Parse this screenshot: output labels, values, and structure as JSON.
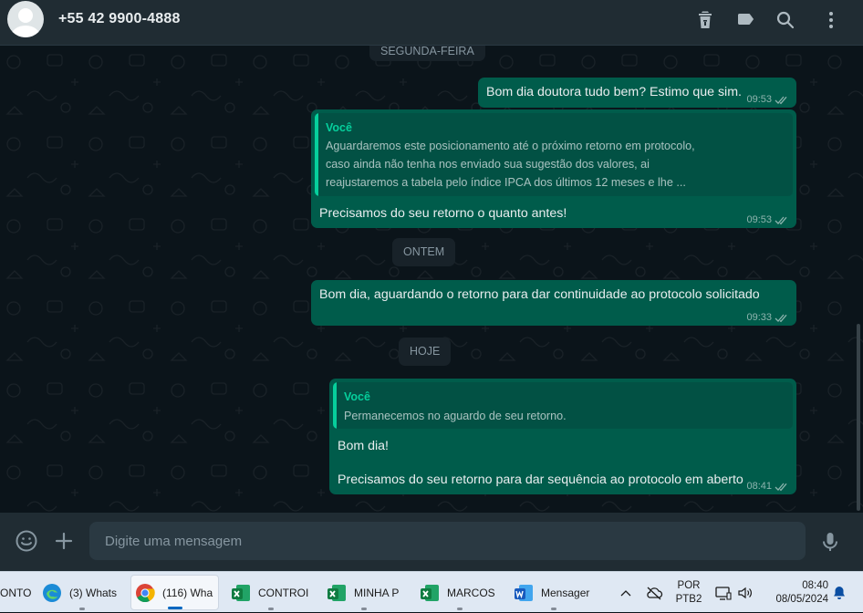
{
  "header": {
    "contact_name": "+55 42 9900-4888",
    "icons": [
      "avatar",
      "trash-icon",
      "label-icon",
      "search-icon",
      "menu-icon"
    ]
  },
  "chat": {
    "day_chips": {
      "monday": "SEGUNDA-FEIRA",
      "yesterday": "ONTEM",
      "today": "HOJE"
    },
    "messages": [
      {
        "text": "Bom dia doutora tudo bem? Estimo que sim.",
        "time": "09:53"
      },
      {
        "quote_author": "Você",
        "quote_text": "Aguardaremos este posicionamento até o próximo retorno em protocolo,\ncaso ainda não tenha nos enviado sua sugestão dos valores, ai\nreajustaremos a tabela pelo índice IPCA dos últimos 12 meses e lhe ...",
        "text": "Precisamos do seu retorno o quanto antes!",
        "time": "09:53"
      },
      {
        "text": "Bom dia, aguardando o retorno para dar continuidade ao protocolo solicitado",
        "time": "09:33"
      },
      {
        "quote_author": "Você",
        "quote_text": "Permanecemos no aguardo de seu retorno.",
        "text": "Bom dia!",
        "text2": "Precisamos do seu retorno para dar sequência ao protocolo em aberto",
        "time": "08:41"
      }
    ]
  },
  "composer": {
    "placeholder": "Digite uma mensagem"
  },
  "taskbar": {
    "items": [
      {
        "label": "ONTO",
        "icon": "app-icon"
      },
      {
        "label": "(3) Whats",
        "icon": "edge-icon"
      },
      {
        "label": "(116) Wha",
        "icon": "chrome-icon"
      },
      {
        "label": "CONTROI",
        "icon": "excel-icon"
      },
      {
        "label": "MINHA P",
        "icon": "excel-icon"
      },
      {
        "label": "MARCOS",
        "icon": "excel-icon"
      },
      {
        "label": "Mensager",
        "icon": "word-icon"
      }
    ],
    "language": "POR",
    "layout": "PTB2",
    "clock_time": "08:40",
    "clock_date": "08/05/2024"
  },
  "colors": {
    "header_bg": "#202c33",
    "chat_bg": "#0b141a",
    "outgoing_bubble": "#005c4b",
    "accent": "#06cf9c",
    "taskbar_bg": "#dfe8f3"
  }
}
